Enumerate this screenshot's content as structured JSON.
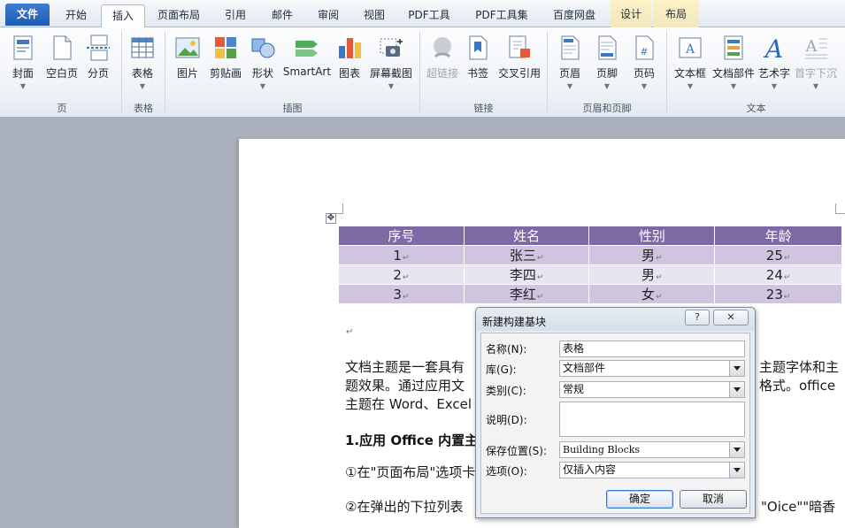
{
  "tabs": [
    {
      "label": "文件",
      "kind": "file"
    },
    {
      "label": "开始"
    },
    {
      "label": "插入",
      "active": true
    },
    {
      "label": "页面布局"
    },
    {
      "label": "引用"
    },
    {
      "label": "邮件"
    },
    {
      "label": "审阅"
    },
    {
      "label": "视图"
    },
    {
      "label": "PDF工具"
    },
    {
      "label": "PDF工具集"
    },
    {
      "label": "百度网盘"
    },
    {
      "label": "设计",
      "contextual": true
    },
    {
      "label": "布局",
      "contextual": true
    }
  ],
  "ribbon": {
    "buttons": [
      {
        "label": "封面",
        "icon": "cover-page-icon",
        "dropdown": true
      },
      {
        "label": "空白页",
        "icon": "blank-page-icon"
      },
      {
        "label": "分页",
        "icon": "page-break-icon"
      },
      {
        "label": "表格",
        "icon": "table-icon",
        "dropdown": true
      },
      {
        "label": "图片",
        "icon": "picture-icon"
      },
      {
        "label": "剪贴画",
        "icon": "clip-art-icon"
      },
      {
        "label": "形状",
        "icon": "shapes-icon",
        "dropdown": true
      },
      {
        "label": "SmartArt",
        "icon": "smartart-icon"
      },
      {
        "label": "图表",
        "icon": "chart-icon"
      },
      {
        "label": "屏幕截图",
        "icon": "screenshot-icon",
        "dropdown": true
      },
      {
        "label": "超链接",
        "icon": "hyperlink-icon",
        "disabled": true
      },
      {
        "label": "书签",
        "icon": "bookmark-icon"
      },
      {
        "label": "交叉引用",
        "icon": "cross-reference-icon"
      },
      {
        "label": "页眉",
        "icon": "header-icon",
        "dropdown": true
      },
      {
        "label": "页脚",
        "icon": "footer-icon",
        "dropdown": true
      },
      {
        "label": "页码",
        "icon": "page-number-icon",
        "dropdown": true
      },
      {
        "label": "文本框",
        "icon": "text-box-icon",
        "dropdown": true
      },
      {
        "label": "文档部件",
        "icon": "quick-parts-icon",
        "dropdown": true
      },
      {
        "label": "艺术字",
        "icon": "wordart-icon",
        "dropdown": true
      },
      {
        "label": "首字下沉",
        "icon": "drop-cap-icon",
        "dropdown": true,
        "disabled": true
      }
    ],
    "groups": [
      "页",
      "表格",
      "插图",
      "链接",
      "页眉和页脚",
      "文本"
    ]
  },
  "table": {
    "headers": [
      "序号",
      "姓名",
      "性别",
      "年龄"
    ],
    "rows": [
      [
        "1",
        "张三",
        "男",
        "25"
      ],
      [
        "2",
        "李四",
        "男",
        "24"
      ],
      [
        "3",
        "李红",
        "女",
        "23"
      ]
    ]
  },
  "doc": {
    "lines": [
      "文档主题是一套具有",
      "题效果。通过应用文",
      "主题在 Word、Excel"
    ],
    "right_lines": [
      "主题字体和主",
      "格式。office"
    ],
    "heading": "1.应用  Office 内置主",
    "step1": "①在\"页面布局\"选项卡",
    "step2": "②在弹出的下拉列表",
    "step2_right": "\"Oice\"\"暗香"
  },
  "dialog": {
    "title": "新建构建基块",
    "help": "?",
    "close": "✕",
    "name_label": "名称(N):",
    "name_value": "表格",
    "gallery_label": "库(G):",
    "gallery_value": "文档部件",
    "category_label": "类别(C):",
    "category_value": "常规",
    "desc_label": "说明(D):",
    "desc_value": "",
    "save_label": "保存位置(S):",
    "save_value": "Building Blocks",
    "options_label": "选项(O):",
    "options_value": "仅插入内容",
    "ok": "确定",
    "cancel": "取消"
  }
}
